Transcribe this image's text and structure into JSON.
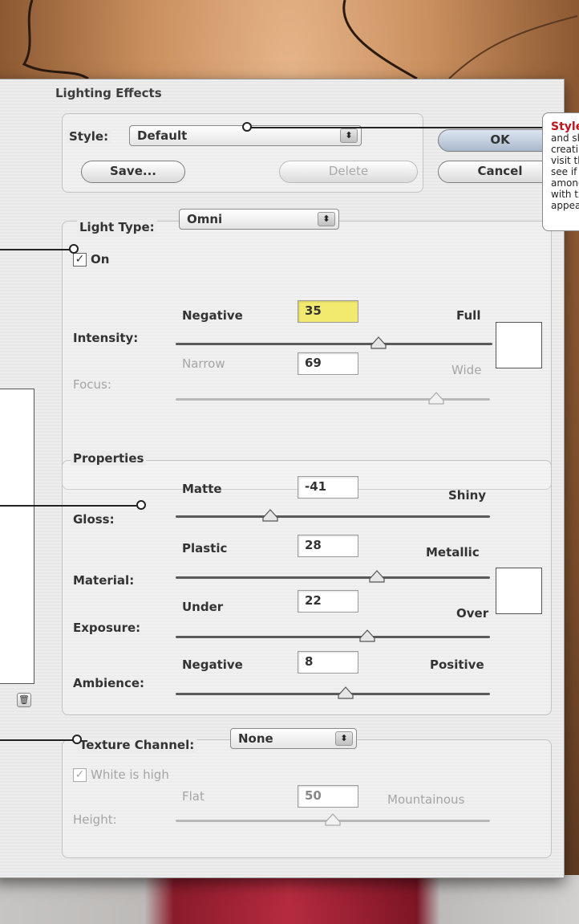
{
  "dialog": {
    "title": "Lighting Effects",
    "style": {
      "label": "Style:",
      "value": "Default"
    },
    "buttons": {
      "ok": "OK",
      "cancel": "Cancel",
      "save": "Save...",
      "delete": "Delete"
    },
    "light_type": {
      "label": "Light Type:",
      "value": "Omni",
      "on_label": "On",
      "on_checked": true,
      "intensity": {
        "label": "Intensity:",
        "min_label": "Negative",
        "max_label": "Full",
        "value": "35",
        "position": 0.64
      },
      "focus": {
        "label": "Focus:",
        "min_label": "Narrow",
        "max_label": "Wide",
        "value": "69",
        "position": 0.83,
        "disabled": true
      }
    },
    "properties": {
      "label": "Properties",
      "gloss": {
        "label": "Gloss:",
        "min_label": "Matte",
        "max_label": "Shiny",
        "value": "-41",
        "position": 0.3
      },
      "material": {
        "label": "Material:",
        "min_label": "Plastic",
        "max_label": "Metallic",
        "value": "28",
        "position": 0.64
      },
      "exposure": {
        "label": "Exposure:",
        "min_label": "Under",
        "max_label": "Over",
        "value": "22",
        "position": 0.61
      },
      "ambience": {
        "label": "Ambience:",
        "min_label": "Negative",
        "max_label": "Positive",
        "value": "8",
        "position": 0.54
      }
    },
    "texture": {
      "label": "Texture Channel:",
      "value": "None",
      "white_is_high_label": "White is high",
      "white_is_high_checked": true,
      "height": {
        "label": "Height:",
        "min_label": "Flat",
        "max_label": "Mountainous",
        "value": "50",
        "position": 0.5,
        "disabled": true
      }
    }
  },
  "callout": {
    "title": "Style",
    "lines": [
      "and sh",
      "creatin",
      "visit th",
      "see if t",
      "among",
      "with th",
      "appea"
    ]
  },
  "colors": {
    "highlight_field": "#f2ea6f",
    "callout_title": "#c2121c"
  }
}
